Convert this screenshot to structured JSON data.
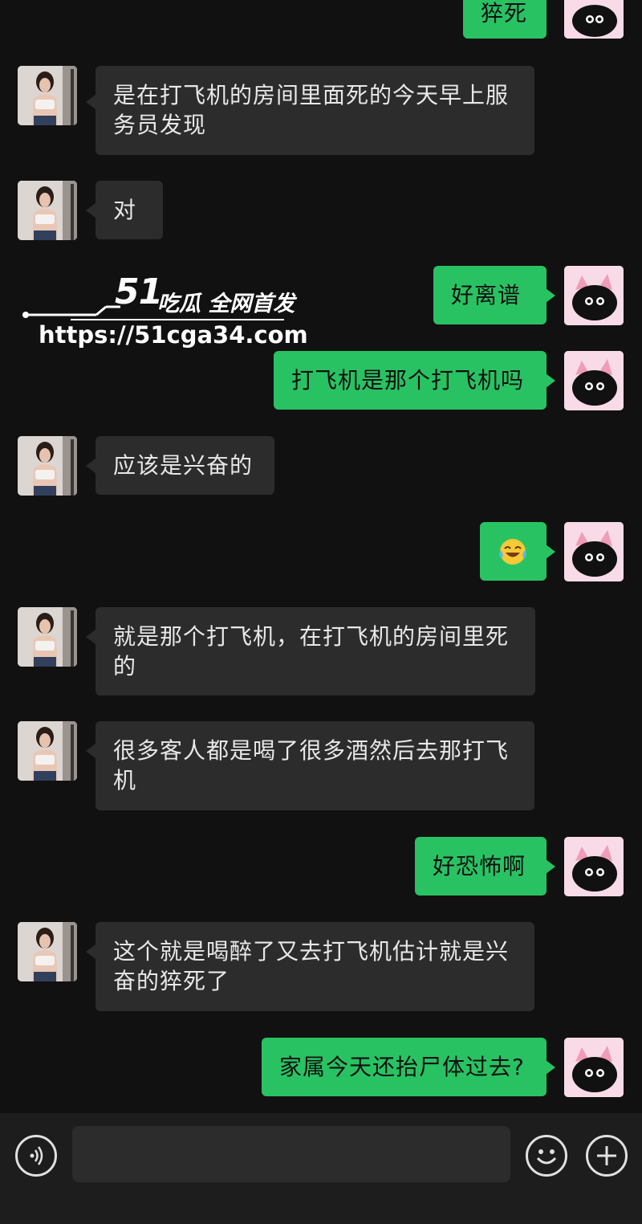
{
  "messages": [
    {
      "id": 0,
      "side": "right",
      "text": "猝死"
    },
    {
      "id": 1,
      "side": "left",
      "text": "是在打飞机的房间里面死的今天早上服务员发现"
    },
    {
      "id": 2,
      "side": "left",
      "text": "对"
    },
    {
      "id": 3,
      "side": "right",
      "text": "好离谱"
    },
    {
      "id": 4,
      "side": "right",
      "text": "打飞机是那个打飞机吗"
    },
    {
      "id": 5,
      "side": "left",
      "text": "应该是兴奋的"
    },
    {
      "id": 6,
      "side": "right",
      "text": "",
      "emoji": "laughing-crying-emoji"
    },
    {
      "id": 7,
      "side": "left",
      "text": "就是那个打飞机，在打飞机的房间里死的"
    },
    {
      "id": 8,
      "side": "left",
      "text": "很多客人都是喝了很多酒然后去那打飞机"
    },
    {
      "id": 9,
      "side": "right",
      "text": "好恐怖啊"
    },
    {
      "id": 10,
      "side": "left",
      "text": "这个就是喝醉了又去打飞机估计就是兴奋的猝死了"
    },
    {
      "id": 11,
      "side": "right",
      "text": "家属今天还抬尸体过去?"
    }
  ],
  "watermark": {
    "logo": "51",
    "tagline": "吃瓜 全网首发",
    "url": "https://51cga34.com"
  },
  "bottom_bar": {
    "voice_icon": "voice-icon",
    "emoji_icon": "emoji-icon",
    "plus_icon": "plus-icon",
    "input_value": ""
  },
  "colors": {
    "background": "#111111",
    "incoming_bubble": "#2c2c2c",
    "outgoing_bubble": "#29c263"
  }
}
